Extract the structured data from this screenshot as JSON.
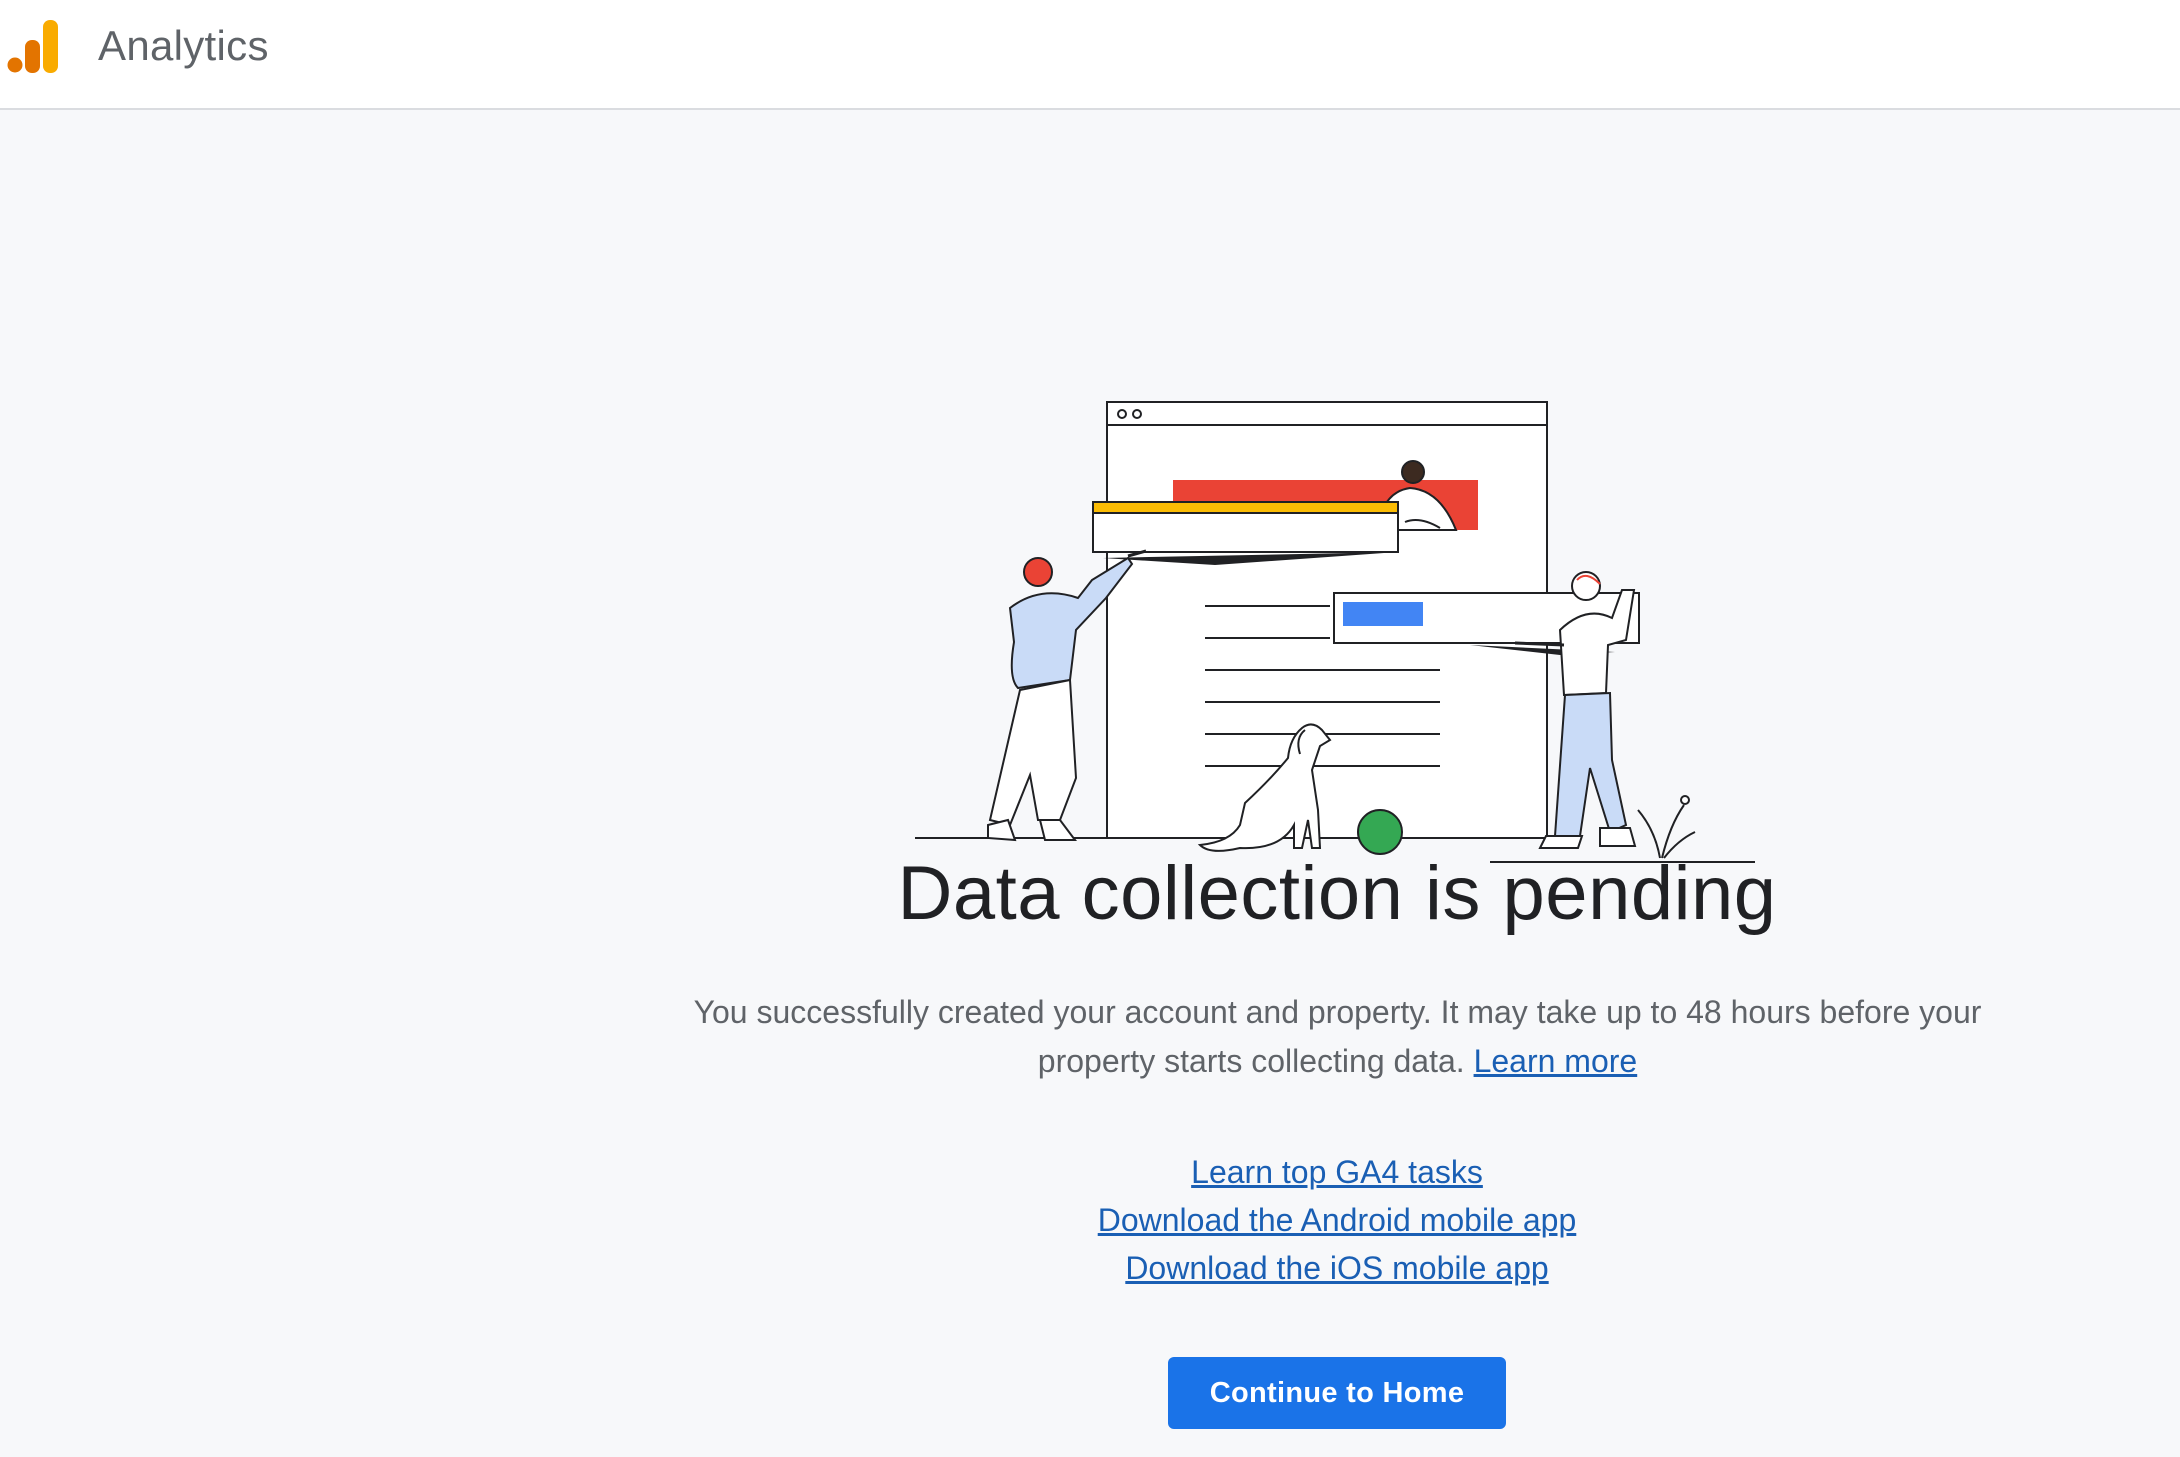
{
  "header": {
    "app_name": "Analytics",
    "logo_icon": "analytics-logo-icon"
  },
  "main": {
    "illustration_icon": "pending-data-illustration",
    "title": "Data collection is pending",
    "description": "You successfully created your account and property. It may take up to 48 hours before your property starts collecting data.",
    "learn_more_label": "Learn more",
    "links": [
      {
        "label": "Learn top GA4 tasks"
      },
      {
        "label": "Download the Android mobile app"
      },
      {
        "label": "Download the iOS mobile app"
      }
    ],
    "continue_button_label": "Continue to Home"
  },
  "colors": {
    "accent": "#1a73e8",
    "link": "#1a5fb4",
    "logo_orange": "#e37400",
    "logo_yellow": "#f9ab00"
  }
}
